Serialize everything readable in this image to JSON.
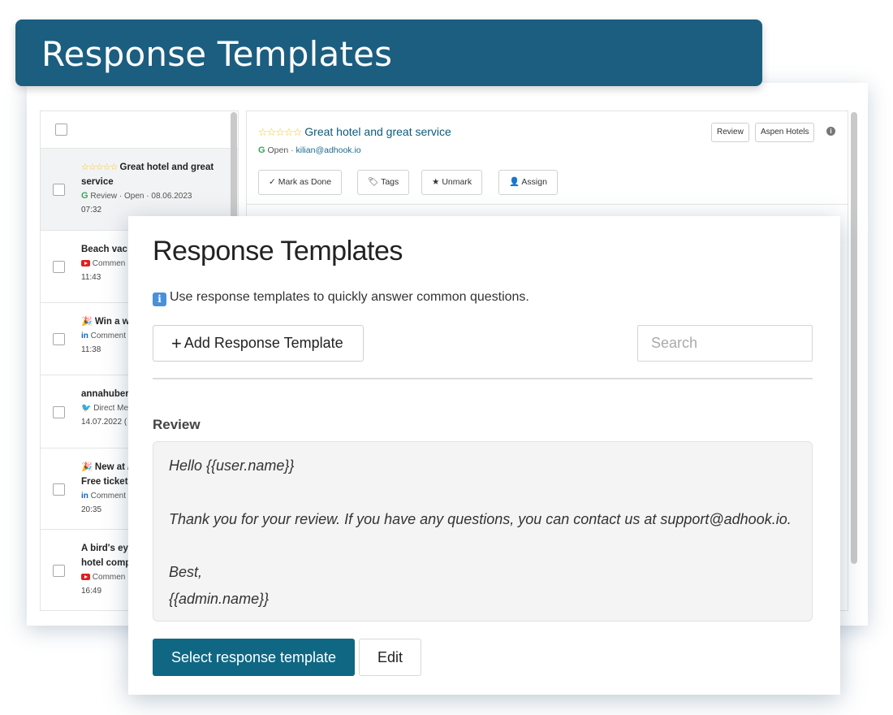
{
  "banner": {
    "title": "Response Templates"
  },
  "list": {
    "items": [
      {
        "stars": "☆☆☆☆☆",
        "title": "Great hotel and great service",
        "channel_icon": "google-icon",
        "channel": "Review",
        "status": "Open",
        "date": "08.06.2023",
        "time": "07:32"
      },
      {
        "title": "Beach vac",
        "channel_icon": "youtube-icon",
        "channel": "Commen",
        "time": "11:43"
      },
      {
        "emoji": "🎉",
        "title": "Win a w",
        "channel_icon": "linkedin-icon",
        "channel": "Comment",
        "time": "11:38"
      },
      {
        "title": "annahuber",
        "channel_icon": "twitter-icon",
        "channel": "Direct Me",
        "time": "14.07.2022 ("
      },
      {
        "emoji": "🎉",
        "title": "New at /",
        "title2": "Free ticket",
        "channel_icon": "linkedin-icon",
        "channel": "Comment",
        "time": "20:35"
      },
      {
        "title": "A bird's ey",
        "title2": "hotel comp",
        "channel_icon": "youtube-icon",
        "channel": "Commen",
        "time": "16:49"
      }
    ]
  },
  "detail": {
    "stars": "☆☆☆☆☆",
    "title": "Great hotel and great service",
    "status": "Open",
    "email": "kilian@adhook.io",
    "badges": [
      "Review",
      "Aspen Hotels"
    ],
    "actions": {
      "mark_done": "Mark as Done",
      "tags": "Tags",
      "unmark": "Unmark",
      "assign": "Assign"
    }
  },
  "modal": {
    "title": "Response Templates",
    "info": "Use response templates to quickly answer common questions.",
    "add_button": "Add Response Template",
    "search_placeholder": "Search",
    "section_label": "Review",
    "template_lines": [
      "Hello {{user.name}}",
      "Thank you for your review. If you have any questions, you can contact us at support@adhook.io.",
      "Best,",
      "{{admin.name}}"
    ],
    "select_button": "Select response template",
    "edit_button": "Edit"
  },
  "colors": {
    "banner": "#1c5e80",
    "primary_button": "#0f6783",
    "link": "#0d5a7a",
    "star": "#f5c518"
  }
}
